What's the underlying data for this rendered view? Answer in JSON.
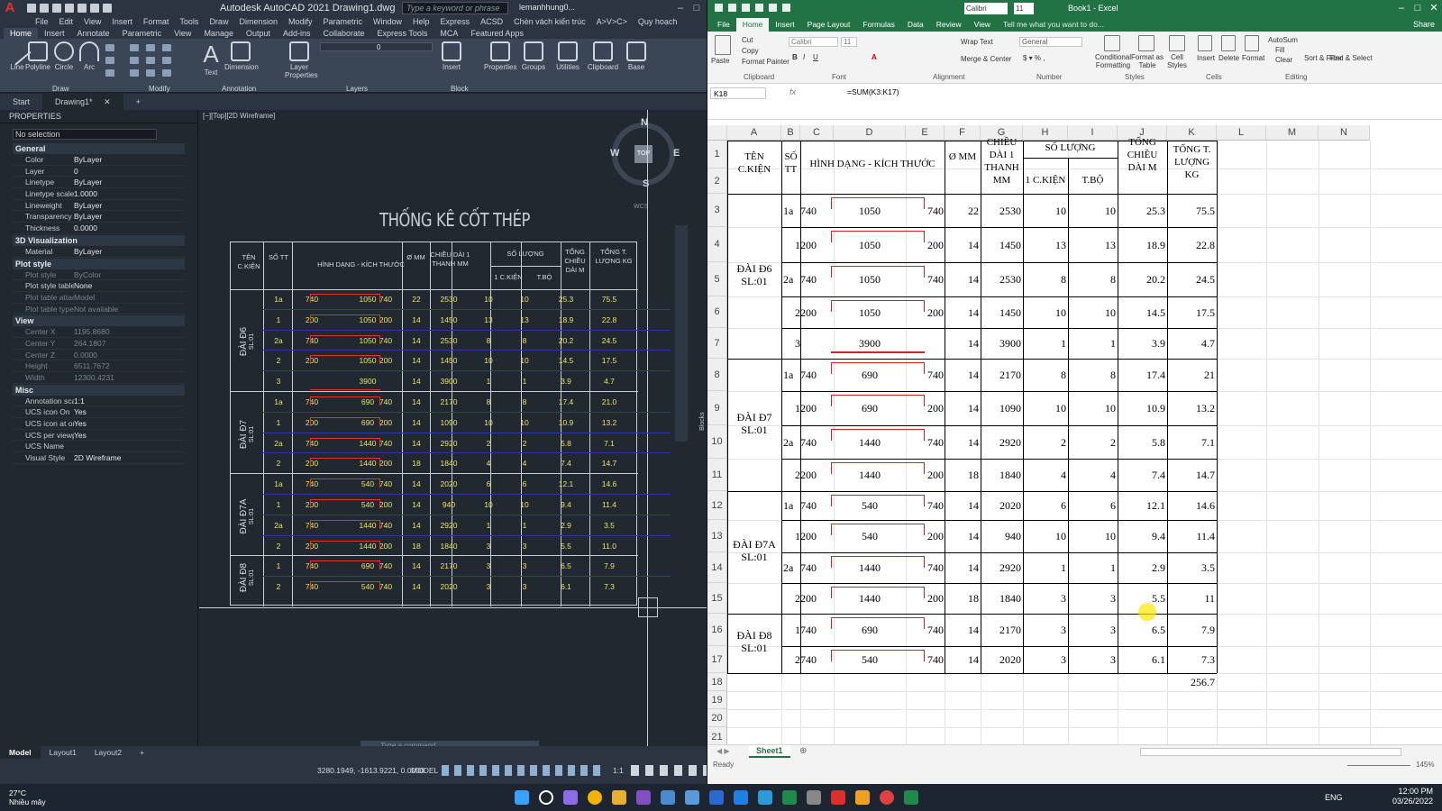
{
  "acad": {
    "title": "Autodesk AutoCAD 2021   Drawing1.dwg",
    "search_placeholder": "Type a keyword or phrase",
    "user": "lemanhhung0...",
    "menu": [
      "File",
      "Edit",
      "View",
      "Insert",
      "Format",
      "Tools",
      "Draw",
      "Dimension",
      "Modify",
      "Parametric",
      "Window",
      "Help",
      "Express",
      "ACSD",
      "Chèn vách kiến trúc",
      "A>V>C>",
      "Quy hoạch"
    ],
    "ribbon_tabs": [
      "Home",
      "Insert",
      "Annotate",
      "Parametric",
      "View",
      "Manage",
      "Output",
      "Add-ins",
      "Collaborate",
      "Express Tools",
      "MCA",
      "Featured Apps"
    ],
    "tools": [
      "Line",
      "Polyline",
      "Circle",
      "Arc",
      "Text",
      "Dimension",
      "Layer Properties",
      "Insert",
      "Properties",
      "Groups",
      "Utilities",
      "Clipboard",
      "Base"
    ],
    "groups": [
      "Draw",
      "Modify",
      "Annotation",
      "Layers",
      "Block"
    ],
    "layer_value": "0",
    "doc_tabs": [
      "Start",
      "Drawing1*"
    ],
    "properties_title": "PROPERTIES",
    "selection": "No selection",
    "sections": {
      "general": {
        "title": "General",
        "rows": [
          [
            "Color",
            "ByLayer"
          ],
          [
            "Layer",
            "0"
          ],
          [
            "Linetype",
            "ByLayer"
          ],
          [
            "Linetype scale",
            "1.0000"
          ],
          [
            "Lineweight",
            "ByLayer"
          ],
          [
            "Transparency",
            "ByLayer"
          ],
          [
            "Thickness",
            "0.0000"
          ]
        ]
      },
      "viz": {
        "title": "3D Visualization",
        "rows": [
          [
            "Material",
            "ByLayer"
          ]
        ]
      },
      "plot": {
        "title": "Plot style",
        "rows": [
          [
            "Plot style",
            "ByColor"
          ],
          [
            "Plot style table",
            "None"
          ],
          [
            "Plot table attache...",
            "Model"
          ],
          [
            "Plot table type",
            "Not available"
          ]
        ]
      },
      "view": {
        "title": "View",
        "rows": [
          [
            "Center X",
            "1195.8680"
          ],
          [
            "Center Y",
            "264.1807"
          ],
          [
            "Center Z",
            "0.0000"
          ],
          [
            "Height",
            "6511.7672"
          ],
          [
            "Width",
            "12300.4231"
          ]
        ]
      },
      "misc": {
        "title": "Misc",
        "rows": [
          [
            "Annotation scale",
            "1:1"
          ],
          [
            "UCS icon On",
            "Yes"
          ],
          [
            "UCS icon at origin",
            "Yes"
          ],
          [
            "UCS per viewport",
            "Yes"
          ],
          [
            "UCS Name",
            ""
          ],
          [
            "Visual Style",
            "2D Wireframe"
          ]
        ]
      }
    },
    "viewport_label": "[−][Top][2D Wireframe]",
    "cad_title": "THỐNG KÊ CỐT THÉP",
    "compass": {
      "n": "N",
      "s": "S",
      "e": "E",
      "w": "W",
      "top": "TOP",
      "wcs": "WCS"
    },
    "blocks_label": "Blocks",
    "command_placeholder": "Type a command",
    "model_tabs": [
      "Model",
      "Layout1",
      "Layout2"
    ],
    "coords": "3280.1949, -1613.9221, 0.0000",
    "model_label": "MODEL",
    "scale": "1:1"
  },
  "cad_headers": {
    "ten": "TÊN C.KIỆN",
    "so": "SỐ TT",
    "hinh": "HÌNH DẠNG - KÍCH THƯỚC",
    "phi": "Ø MM",
    "dai": "CHIỀU DÀI 1 THANH MM",
    "sl": "SỐ LƯỢNG",
    "ck": "1 C.KIỆN",
    "tb": "T.BỘ",
    "tong": "TỔNG CHIỀU DÀI M",
    "kg": "TỔNG T. LƯỢNG KG"
  },
  "cad_groups": [
    {
      "name": "ĐÀI Đ6",
      "sub": "SL:01"
    },
    {
      "name": "ĐÀI Đ7",
      "sub": "SL:01"
    },
    {
      "name": "ĐÀI Đ7A",
      "sub": "SL:01"
    },
    {
      "name": "ĐÀI Đ8",
      "sub": "SL:01"
    }
  ],
  "cad_rows": [
    [
      "1a",
      "740",
      "1050",
      "740",
      "22",
      "2530",
      "10",
      "10",
      "25.3",
      "75.5"
    ],
    [
      "1",
      "200",
      "1050",
      "200",
      "14",
      "1450",
      "13",
      "13",
      "18.9",
      "22.8"
    ],
    [
      "2a",
      "740",
      "1050",
      "740",
      "14",
      "2530",
      "8",
      "8",
      "20.2",
      "24.5"
    ],
    [
      "2",
      "200",
      "1050",
      "200",
      "14",
      "1450",
      "10",
      "10",
      "14.5",
      "17.5"
    ],
    [
      "3",
      "",
      "3900",
      "",
      "14",
      "3900",
      "1",
      "1",
      "3.9",
      "4.7"
    ],
    [
      "1a",
      "740",
      "690",
      "740",
      "14",
      "2170",
      "8",
      "8",
      "17.4",
      "21.0"
    ],
    [
      "1",
      "200",
      "690",
      "200",
      "14",
      "1090",
      "10",
      "10",
      "10.9",
      "13.2"
    ],
    [
      "2a",
      "740",
      "1440",
      "740",
      "14",
      "2920",
      "2",
      "2",
      "5.8",
      "7.1"
    ],
    [
      "2",
      "200",
      "1440",
      "200",
      "18",
      "1840",
      "4",
      "4",
      "7.4",
      "14.7"
    ],
    [
      "1a",
      "740",
      "540",
      "740",
      "14",
      "2020",
      "6",
      "6",
      "12.1",
      "14.6"
    ],
    [
      "1",
      "200",
      "540",
      "200",
      "14",
      "940",
      "10",
      "10",
      "9.4",
      "11.4"
    ],
    [
      "2a",
      "740",
      "1440",
      "740",
      "14",
      "2920",
      "1",
      "1",
      "2.9",
      "3.5"
    ],
    [
      "2",
      "200",
      "1440",
      "200",
      "18",
      "1840",
      "3",
      "3",
      "5.5",
      "11.0"
    ],
    [
      "1",
      "740",
      "690",
      "740",
      "14",
      "2170",
      "3",
      "3",
      "6.5",
      "7.9"
    ],
    [
      "2",
      "740",
      "540",
      "740",
      "14",
      "2020",
      "3",
      "3",
      "6.1",
      "7.3"
    ]
  ],
  "xl": {
    "title": "Book1 - Excel",
    "font": "Calibri",
    "size": "11",
    "tabs": [
      "File",
      "Home",
      "Insert",
      "Page Layout",
      "Formulas",
      "Data",
      "Review",
      "View"
    ],
    "tell": "Tell me what you want to do...",
    "share": "Share",
    "ribbon": {
      "paste": "Paste",
      "cut": "Cut",
      "copy": "Copy",
      "painter": "Format Painter",
      "wrap": "Wrap Text",
      "merge": "Merge & Center",
      "general": "General",
      "cond": "Conditional Formatting",
      "fmt_table": "Format as Table",
      "cell_styles": "Cell Styles",
      "insert": "Insert",
      "delete": "Delete",
      "format": "Format",
      "autosum": "AutoSum",
      "fill": "Fill",
      "clear": "Clear",
      "sort": "Sort & Filter",
      "find": "Find & Select"
    },
    "groups": [
      "Clipboard",
      "Font",
      "Alignment",
      "Number",
      "Styles",
      "Cells",
      "Editing"
    ],
    "namebox": "K18",
    "formula": "=SUM(K3:K17)",
    "fx": "fx",
    "cols": [
      "A",
      "B",
      "C",
      "D",
      "E",
      "F",
      "G",
      "H",
      "I",
      "J",
      "K",
      "L",
      "M",
      "N"
    ],
    "sheet": "Sheet1",
    "status": "Ready",
    "zoom": "145%",
    "total": "256.7"
  },
  "xl_headers": {
    "a": "TÊN C.KIỆN",
    "b": "SỐ TT",
    "d": "HÌNH DẠNG - KÍCH THƯỚC",
    "f": "Ø MM",
    "g": "CHIỀU DÀI 1 THANH MM",
    "h": "SỐ LƯỢNG",
    "h2": "1 C.KIỆN",
    "i2": "T.BỘ",
    "j": "TỔNG CHIỀU DÀI M",
    "k": "TỔNG T. LƯỢNG KG"
  },
  "xl_groups": [
    {
      "name": "ĐÀI Đ6 SL:01"
    },
    {
      "name": "ĐÀI Đ7 SL:01"
    },
    {
      "name": "ĐÀI Đ7A SL:01"
    },
    {
      "name": "ĐÀI Đ8 SL:01"
    }
  ],
  "xl_rows": [
    [
      "1a",
      "740",
      "1050",
      "740",
      "22",
      "2530",
      "10",
      "10",
      "25.3",
      "75.5"
    ],
    [
      "1",
      "200",
      "1050",
      "200",
      "14",
      "1450",
      "13",
      "13",
      "18.9",
      "22.8"
    ],
    [
      "2a",
      "740",
      "1050",
      "740",
      "14",
      "2530",
      "8",
      "8",
      "20.2",
      "24.5"
    ],
    [
      "2",
      "200",
      "1050",
      "200",
      "14",
      "1450",
      "10",
      "10",
      "14.5",
      "17.5"
    ],
    [
      "3",
      "",
      "3900",
      "",
      "14",
      "3900",
      "1",
      "1",
      "3.9",
      "4.7"
    ],
    [
      "1a",
      "740",
      "690",
      "740",
      "14",
      "2170",
      "8",
      "8",
      "17.4",
      "21"
    ],
    [
      "1",
      "200",
      "690",
      "200",
      "14",
      "1090",
      "10",
      "10",
      "10.9",
      "13.2"
    ],
    [
      "2a",
      "740",
      "1440",
      "740",
      "14",
      "2920",
      "2",
      "2",
      "5.8",
      "7.1"
    ],
    [
      "2",
      "200",
      "1440",
      "200",
      "18",
      "1840",
      "4",
      "4",
      "7.4",
      "14.7"
    ],
    [
      "1a",
      "740",
      "540",
      "740",
      "14",
      "2020",
      "6",
      "6",
      "12.1",
      "14.6"
    ],
    [
      "1",
      "200",
      "540",
      "200",
      "14",
      "940",
      "10",
      "10",
      "9.4",
      "11.4"
    ],
    [
      "2a",
      "740",
      "1440",
      "740",
      "14",
      "2920",
      "1",
      "1",
      "2.9",
      "3.5"
    ],
    [
      "2",
      "200",
      "1440",
      "200",
      "18",
      "1840",
      "3",
      "3",
      "5.5",
      "11"
    ],
    [
      "1",
      "740",
      "690",
      "740",
      "14",
      "2170",
      "3",
      "3",
      "6.5",
      "7.9"
    ],
    [
      "2",
      "740",
      "540",
      "740",
      "14",
      "2020",
      "3",
      "3",
      "6.1",
      "7.3"
    ]
  ],
  "taskbar": {
    "temp": "27°C",
    "weather": "Nhiều mây",
    "lang": "ENG",
    "time": "12:00 PM",
    "date": "03/26/2022"
  }
}
